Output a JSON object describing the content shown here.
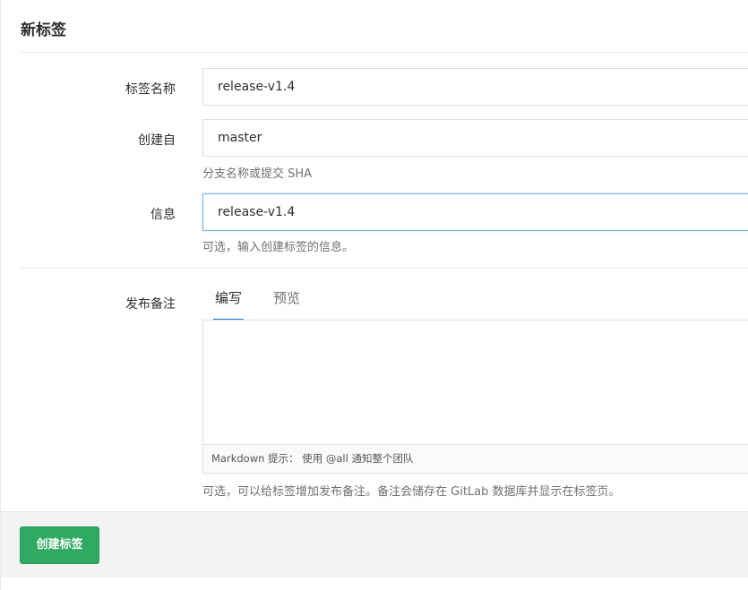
{
  "page": {
    "title": "新标签"
  },
  "form": {
    "tag_name": {
      "label": "标签名称",
      "value": "release-v1.4"
    },
    "create_from": {
      "label": "创建自",
      "value": "master",
      "help": "分支名称或提交 SHA"
    },
    "message": {
      "label": "信息",
      "value": "release-v1.4",
      "help": "可选，输入创建标签的信息。"
    },
    "release_notes": {
      "label": "发布备注",
      "tabs": [
        "编写",
        "预览"
      ],
      "active_tab": "编写",
      "markdown_hint": "Markdown 提示： 使用 @all 通知整个团队",
      "help": "可选，可以给标签增加发布备注。备注会储存在 GitLab 数据库并显示在标签页。"
    }
  },
  "footer": {
    "create_button_label": "创建标签"
  },
  "colors": {
    "accent_blue": "#1f78d1",
    "create_button": "#2eaa62",
    "focus_border": "#7db3e4"
  }
}
